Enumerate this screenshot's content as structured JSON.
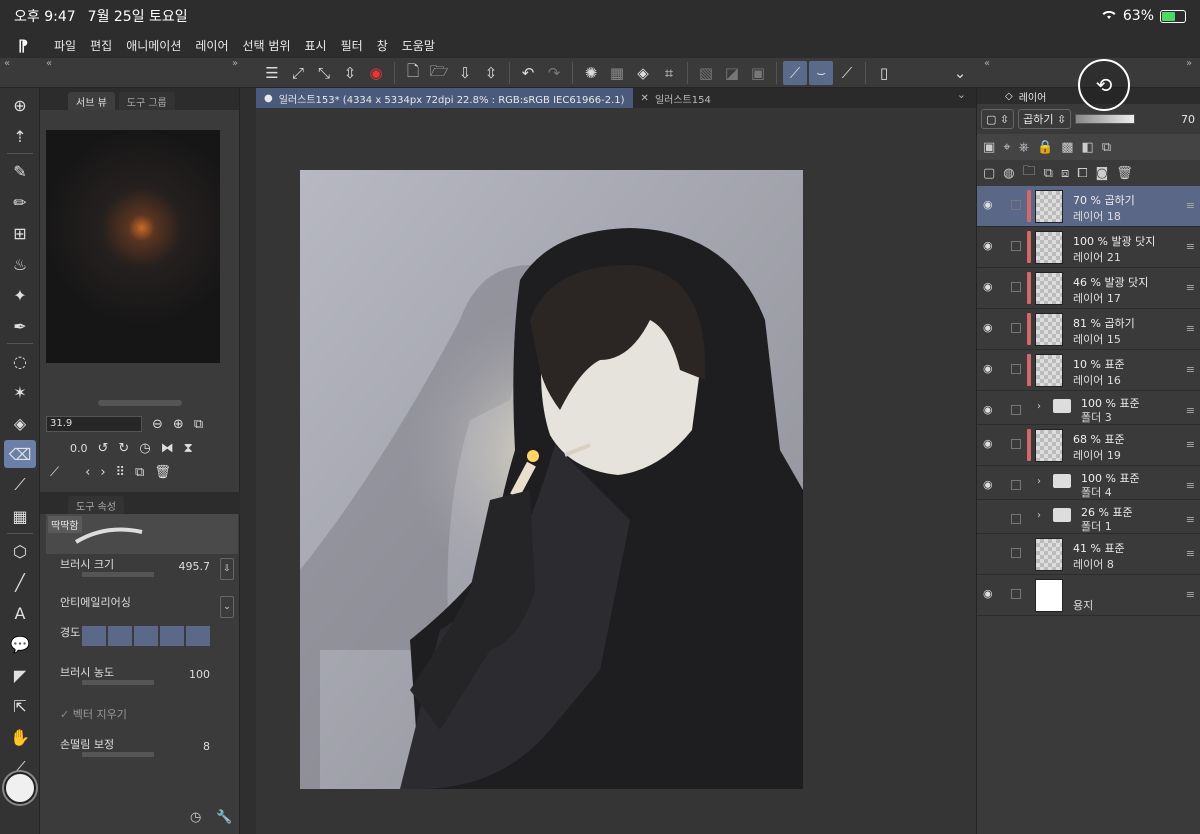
{
  "status": {
    "time": "오후 9:47",
    "date": "7월 25일 토요일",
    "battery": "63%",
    "battery_level": 0.63
  },
  "menu": [
    "파일",
    "편집",
    "애니메이션",
    "레이어",
    "선택 범위",
    "표시",
    "필터",
    "창",
    "도움말"
  ],
  "subview": {
    "tabs": [
      "서브 뷰",
      "도구 그룹"
    ],
    "zoom": "31.9",
    "rotation": "0.0"
  },
  "tool_props": {
    "tabs": [
      "도구 속성"
    ],
    "brush_name": "딱딱함",
    "brush_size_label": "브러시 크기",
    "brush_size_value": "495.7",
    "antialias_label": "안티에일리어싱",
    "hardness_label": "경도",
    "density_label": "브러시 농도",
    "density_value": "100",
    "vector_erase_label": "벡터 지우기",
    "stabilizer_label": "손떨림 보정",
    "stabilizer_value": "8"
  },
  "documents": [
    {
      "label": "일러스트153* (4334 x 5334px 72dpi 22.8% : RGB:sRGB IEC61966-2.1)",
      "active": true
    },
    {
      "label": "일러스트154",
      "active": false
    }
  ],
  "layers_panel": {
    "tab": "레이어",
    "blend_mode": "곱하기",
    "opacity": "70",
    "layers": [
      {
        "line1": "70 % 곱하기",
        "name": "레이어 18",
        "type": "layer",
        "selected": true,
        "visible": true,
        "marker": true
      },
      {
        "line1": "100 % 발광 닷지",
        "name": "레이어 21",
        "type": "layer",
        "selected": false,
        "visible": true,
        "marker": true
      },
      {
        "line1": "46 % 발광 닷지",
        "name": "레이어 17",
        "type": "layer",
        "selected": false,
        "visible": true,
        "marker": true
      },
      {
        "line1": "81 % 곱하기",
        "name": "레이어 15",
        "type": "layer",
        "selected": false,
        "visible": true,
        "marker": true
      },
      {
        "line1": "10 % 표준",
        "name": "레이어 16",
        "type": "layer",
        "selected": false,
        "visible": true,
        "marker": true
      },
      {
        "line1": "100 % 표준",
        "name": "폴더 3",
        "type": "folder",
        "selected": false,
        "visible": true,
        "marker": false
      },
      {
        "line1": "68 % 표준",
        "name": "레이어 19",
        "type": "layer",
        "selected": false,
        "visible": true,
        "marker": true
      },
      {
        "line1": "100 % 표준",
        "name": "폴더 4",
        "type": "folder",
        "selected": false,
        "visible": true,
        "marker": false
      },
      {
        "line1": "26 % 표준",
        "name": "폴더 1",
        "type": "folder",
        "selected": false,
        "visible": false,
        "marker": false
      },
      {
        "line1": "41 % 표준",
        "name": "레이어 8",
        "type": "layer",
        "selected": false,
        "visible": false,
        "marker": false
      },
      {
        "line1": "",
        "name": "용지",
        "type": "paper",
        "selected": false,
        "visible": true,
        "marker": false
      }
    ]
  }
}
